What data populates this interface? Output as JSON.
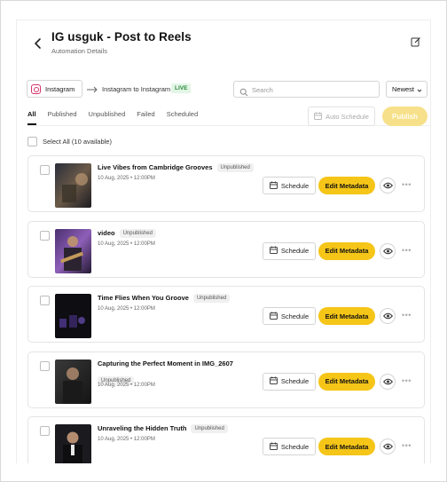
{
  "header": {
    "title": "IG usguk - Post to Reels",
    "subtitle": "Automation Details"
  },
  "connection": {
    "source_label": "Instagram",
    "route_label": "Instagram to Instagram",
    "status_badge": "LIVE"
  },
  "search": {
    "placeholder": "Search",
    "value": ""
  },
  "sort": {
    "selected": "Newest"
  },
  "tabs": [
    {
      "label": "All",
      "active": true
    },
    {
      "label": "Published",
      "active": false
    },
    {
      "label": "Unpublished",
      "active": false
    },
    {
      "label": "Failed",
      "active": false
    },
    {
      "label": "Scheduled",
      "active": false
    }
  ],
  "actions": {
    "auto_schedule_label": "Auto Schedule",
    "publish_label": "Publish"
  },
  "select_all_label": "Select All (10 available)",
  "posts": [
    {
      "title": "Live Vibes from Cambridge Grooves",
      "status": "Unpublished",
      "date": "10 Aug, 2025 • 12:00PM",
      "schedule_label": "Schedule",
      "edit_label": "Edit Metadata"
    },
    {
      "title": "video",
      "status": "Unpublished",
      "date": "10 Aug, 2025 • 12:00PM",
      "schedule_label": "Schedule",
      "edit_label": "Edit Metadata"
    },
    {
      "title": "Time Flies When You Groove",
      "status": "Unpublished",
      "date": "10 Aug, 2025 • 12:00PM",
      "schedule_label": "Schedule",
      "edit_label": "Edit Metadata"
    },
    {
      "title": "Capturing the Perfect Moment in IMG_2607",
      "status": "Unpublished",
      "date": "10 Aug, 2025 • 12:00PM",
      "schedule_label": "Schedule",
      "edit_label": "Edit Metadata"
    },
    {
      "title": "Unraveling the Hidden Truth",
      "status": "Unpublished",
      "date": "10 Aug, 2025 • 12:00PM",
      "schedule_label": "Schedule",
      "edit_label": "Edit Metadata"
    }
  ],
  "colors": {
    "accent": "#f5c518",
    "publish_disabled": "#f7e08a",
    "live": "#2e8b3e",
    "instagram": "#d6336c"
  },
  "icons": [
    "back-arrow-icon",
    "edit-icon",
    "instagram-icon",
    "arrow-right-icon",
    "search-icon",
    "chevron-down-icon",
    "calendar-icon",
    "eye-icon",
    "more-icon"
  ]
}
